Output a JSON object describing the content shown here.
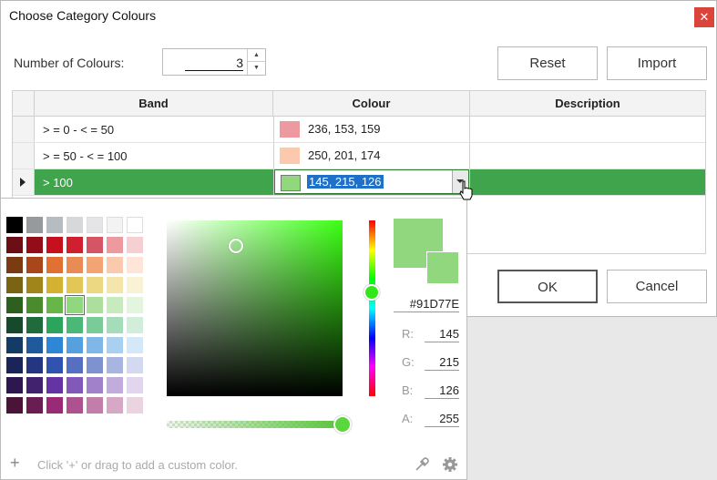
{
  "window": {
    "title": "Choose Category Colours",
    "close_label": "✕"
  },
  "count": {
    "label": "Number of Colours:",
    "value": "3",
    "up_glyph": "▲",
    "down_glyph": "▼"
  },
  "buttons": {
    "reset": "Reset",
    "import": "Import",
    "ok": "OK",
    "cancel": "Cancel"
  },
  "table": {
    "columns": [
      "Band",
      "Colour",
      "Description"
    ],
    "rows": [
      {
        "band": "> = 0 - < = 50",
        "colour_rgb": "236, 153, 159",
        "swatch": "#ec999f",
        "description": ""
      },
      {
        "band": "> = 50 - < = 100",
        "colour_rgb": "250, 201, 174",
        "swatch": "#fac9ae",
        "description": ""
      },
      {
        "band": "> 100",
        "colour_rgb": "145, 215, 126",
        "swatch": "#91d77e",
        "description": ""
      }
    ],
    "selected_row_color": "#3fa44c"
  },
  "picker": {
    "palette": [
      [
        "#000000",
        "#979a9c",
        "#b6bcc2",
        "#d7d8da",
        "#e5e5e7",
        "#f3f3f4",
        "#ffffff"
      ],
      [
        "#6b0e16",
        "#920d17",
        "#c7101d",
        "#d01f2e",
        "#d55564",
        "#ec999f",
        "#f6cfd3"
      ],
      [
        "#7a3b12",
        "#a8471a",
        "#e07133",
        "#e98b54",
        "#f2a474",
        "#fac9ae",
        "#fde6d8"
      ],
      [
        "#7a6312",
        "#a0851b",
        "#d4b231",
        "#e2c656",
        "#ecd783",
        "#f4e6ab",
        "#faf2d4"
      ],
      [
        "#2f5f1e",
        "#4a8b2e",
        "#67b748",
        "#91d77e",
        "#acdf9c",
        "#c8ebbd",
        "#e3f5de"
      ],
      [
        "#174a2c",
        "#1f6b3c",
        "#2ba55c",
        "#4bb877",
        "#79cb98",
        "#a5dcba",
        "#d3eddc"
      ],
      [
        "#143a66",
        "#1f5a9c",
        "#2f86d4",
        "#57a0df",
        "#7fb8e8",
        "#a9d0f0",
        "#d4e8f8"
      ],
      [
        "#1a2459",
        "#243581",
        "#3153b0",
        "#566fc0",
        "#7f92d0",
        "#a7b5e0",
        "#d3daf0"
      ],
      [
        "#2e174f",
        "#41226f",
        "#6534a4",
        "#8258b8",
        "#a281cb",
        "#c2acdd",
        "#e1d6ee"
      ],
      [
        "#4a1338",
        "#6a1d52",
        "#982a76",
        "#ad528e",
        "#c27eaa",
        "#d6a8c6",
        "#ebd4e2"
      ]
    ],
    "hex": "#91D77E",
    "r_label": "R:",
    "r": "145",
    "g_label": "G:",
    "g": "215",
    "b_label": "B:",
    "b": "126",
    "a_label": "A:",
    "a": "255",
    "hint": "Click '+' or drag to add a custom color.",
    "plus_glyph": "+",
    "icons": [
      "plus-icon",
      "eyedropper-icon",
      "gear-icon"
    ]
  }
}
